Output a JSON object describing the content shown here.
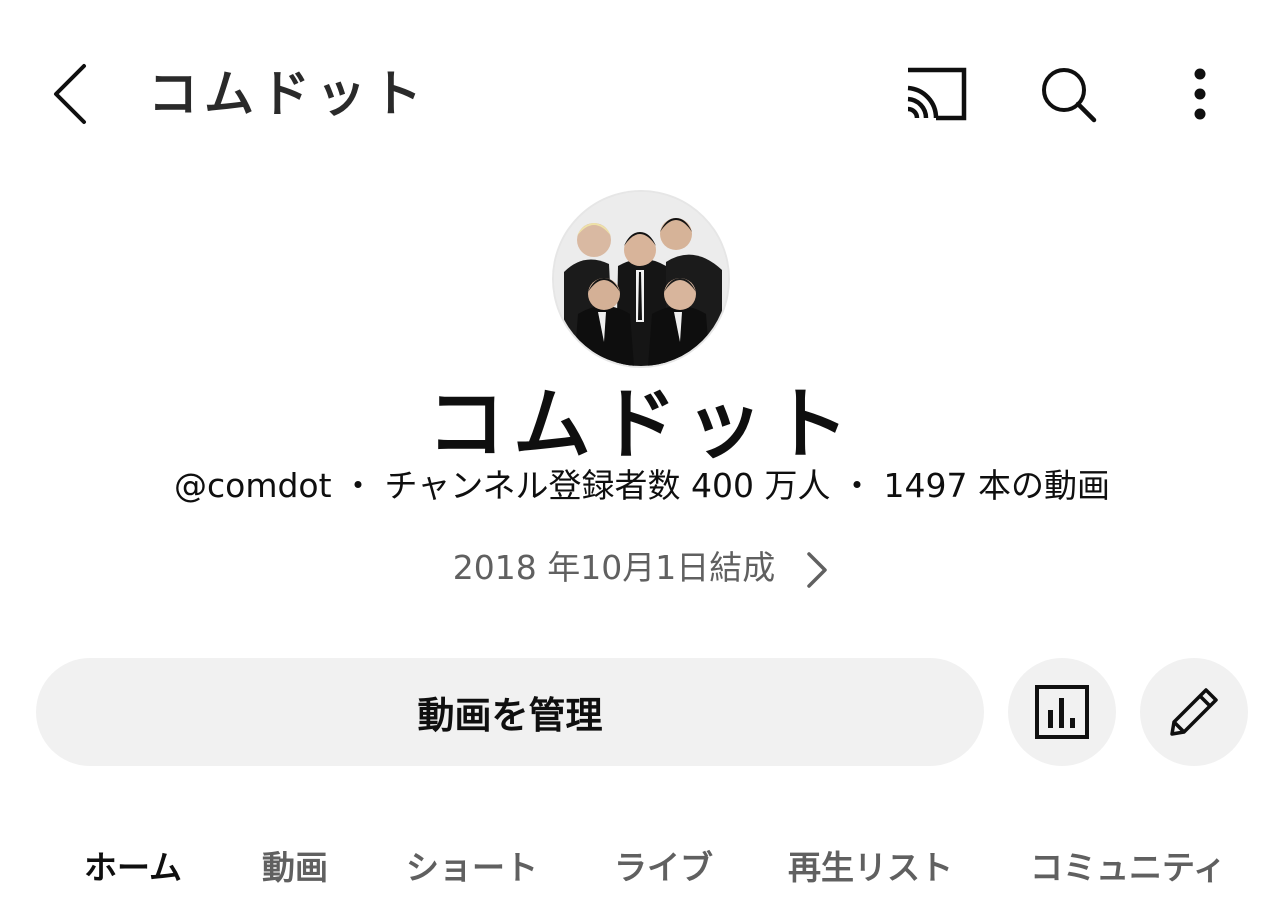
{
  "header": {
    "title": "コムドット",
    "back_icon": "chevron-left-icon",
    "cast_icon": "cast-icon",
    "search_icon": "search-icon",
    "more_icon": "more-vertical-icon"
  },
  "channel": {
    "name": "コムドット",
    "handle": "@comdot",
    "subscribers": "チャンネル登録者数 400 万人",
    "videos": "1497 本の動画",
    "separator": "・",
    "founded": "2018 年10月1日結成"
  },
  "actions": {
    "manage_label": "動画を管理",
    "stats_icon": "analytics-icon",
    "edit_icon": "pencil-icon"
  },
  "tabs": [
    {
      "label": "ホーム",
      "active": true
    },
    {
      "label": "動画",
      "active": false
    },
    {
      "label": "ショート",
      "active": false
    },
    {
      "label": "ライブ",
      "active": false
    },
    {
      "label": "再生リスト",
      "active": false
    },
    {
      "label": "コミュニティ",
      "active": false
    }
  ],
  "colors": {
    "text_primary": "#0f0f0f",
    "text_secondary": "#606060",
    "button_bg": "#f1f1f1"
  }
}
